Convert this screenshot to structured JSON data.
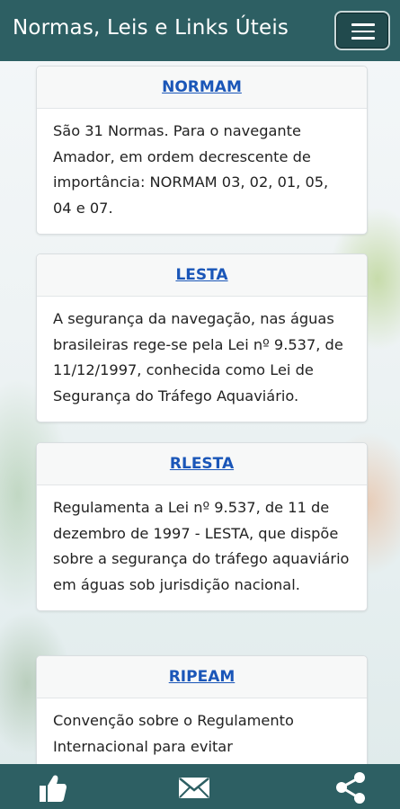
{
  "header": {
    "title": "Normas, Leis e Links Úteis",
    "menu_icon": "hamburger-menu-icon"
  },
  "cards": [
    {
      "title": "NORMAM",
      "text": "São 31 Normas. Para o navegante Amador, em ordem decrescente de importância: NORMAM 03, 02, 01, 05, 04 e 07."
    },
    {
      "title": "LESTA",
      "text": "A segurança da navegação, nas águas brasileiras rege-se pela Lei nº 9.537, de 11/12/1997, conhecida como Lei de Segurança do Tráfego Aquaviário."
    },
    {
      "title": "RLESTA",
      "text": "Regulamenta a Lei nº 9.537, de 11 de dezembro de 1997 - LESTA, que dispõe sobre a segurança do tráfego aquaviário em águas sob jurisdição nacional."
    },
    {
      "title": "RIPEAM",
      "text": "Convenção sobre o Regulamento Internacional para evitar"
    }
  ],
  "bottom_bar": {
    "icons": [
      "thumbs-up-icon",
      "envelope-icon",
      "share-icon"
    ]
  },
  "colors": {
    "bar": "#2d5f63",
    "link": "#1a56b8"
  }
}
